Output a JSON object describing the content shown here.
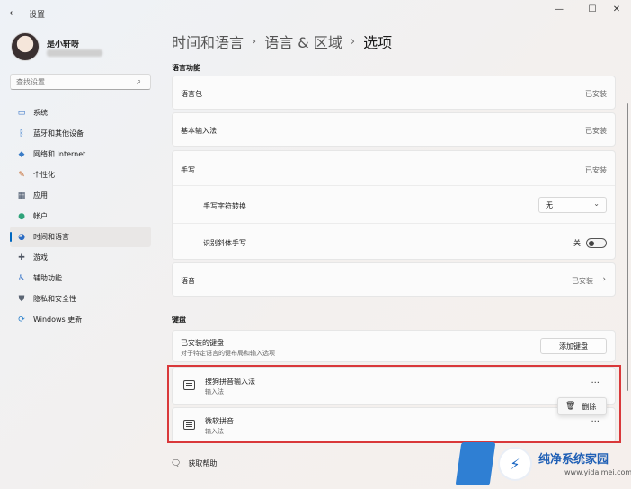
{
  "window": {
    "title": "设置",
    "back_glyph": "←",
    "minimize_glyph": "—",
    "maximize_glyph": "☐",
    "close_glyph": "✕"
  },
  "user": {
    "name": "是小轩呀"
  },
  "search": {
    "placeholder": "查找设置",
    "icon": "search-icon",
    "glyph": "⌕"
  },
  "sidebar": {
    "items": [
      {
        "label": "系统",
        "icon": "monitor-icon",
        "glyph": "▭",
        "color": "#2b6cc4"
      },
      {
        "label": "蓝牙和其他设备",
        "icon": "bluetooth-icon",
        "glyph": "ᛒ",
        "color": "#2f77c9"
      },
      {
        "label": "网络和 Internet",
        "icon": "wifi-icon",
        "glyph": "◆",
        "color": "#3b7dc7"
      },
      {
        "label": "个性化",
        "icon": "brush-icon",
        "glyph": "✎",
        "color": "#c4672b"
      },
      {
        "label": "应用",
        "icon": "apps-icon",
        "glyph": "▦",
        "color": "#3d4b61"
      },
      {
        "label": "帐户",
        "icon": "person-icon",
        "glyph": "●",
        "color": "#2fa37a"
      },
      {
        "label": "时间和语言",
        "icon": "globe-clock-icon",
        "glyph": "◕",
        "color": "#2b6cc4"
      },
      {
        "label": "游戏",
        "icon": "gamepad-icon",
        "glyph": "✚",
        "color": "#4e5562"
      },
      {
        "label": "辅助功能",
        "icon": "accessibility-icon",
        "glyph": "♿",
        "color": "#2b6cc4"
      },
      {
        "label": "隐私和安全性",
        "icon": "shield-icon",
        "glyph": "⛊",
        "color": "#5b6573"
      },
      {
        "label": "Windows 更新",
        "icon": "update-icon",
        "glyph": "⟳",
        "color": "#1f7ac9"
      }
    ],
    "selected_index": 6
  },
  "breadcrumb": {
    "part1": "时间和语言",
    "part2": "语言 & 区域",
    "current": "选项",
    "sep": "›"
  },
  "language_features": {
    "title": "语言功能",
    "language_pack": {
      "label": "语言包",
      "status": "已安装"
    },
    "basic_typing": {
      "label": "基本输入法",
      "status": "已安装"
    },
    "handwriting": {
      "label": "手写",
      "status": "已安装",
      "char_conversion": {
        "label": "手写字符转换",
        "value": "无"
      },
      "italic_recognition": {
        "label": "识别斜体手写",
        "state": "关"
      }
    },
    "speech": {
      "label": "语音",
      "status": "已安装"
    }
  },
  "keyboards": {
    "title": "键盘",
    "installed": {
      "label": "已安装的键盘",
      "desc": "对于特定语言的键布局和输入选项",
      "add_button": "添加键盘"
    },
    "items": [
      {
        "name": "搜狗拼音输入法",
        "type": "输入法"
      },
      {
        "name": "微软拼音",
        "type": "输入法"
      }
    ],
    "more_glyph": "···",
    "context_menu": {
      "delete": "删除"
    }
  },
  "help": {
    "label": "获取帮助"
  },
  "watermark": {
    "title": "纯净系统家园",
    "url": "www.yidaimei.com"
  },
  "colors": {
    "accent": "#0067c0",
    "highlight": "#d9383a"
  }
}
